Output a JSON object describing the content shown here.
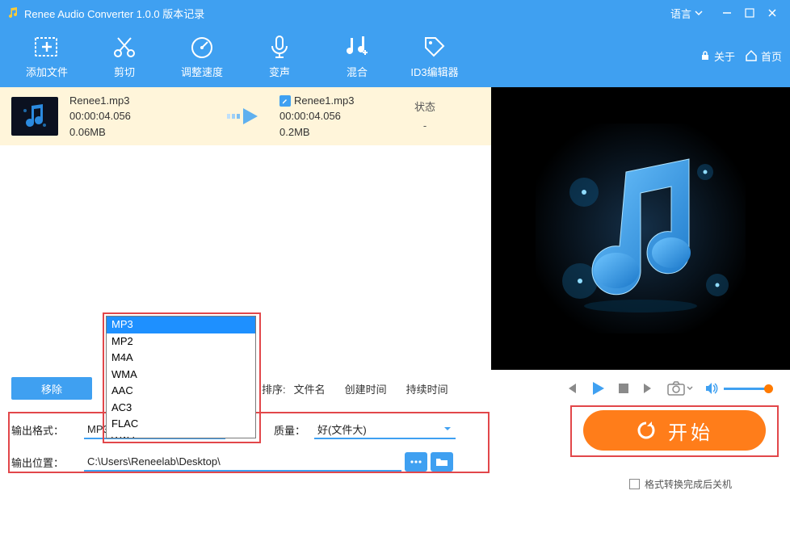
{
  "titlebar": {
    "title": "Renee Audio Converter 1.0.0 版本记录",
    "language": "语言"
  },
  "toolbar": {
    "add": "添加文件",
    "trim": "剪切",
    "speed": "调整速度",
    "voice": "变声",
    "mix": "混合",
    "id3": "ID3编辑器",
    "about": "关于",
    "home": "首页"
  },
  "file": {
    "in_name": "Renee1.mp3",
    "in_dur": "00:00:04.056",
    "in_size": "0.06MB",
    "out_name": "Renee1.mp3",
    "out_dur": "00:00:04.056",
    "out_size": "0.2MB",
    "status_header": "状态",
    "status_value": "-"
  },
  "formats": [
    "MP3",
    "MP2",
    "M4A",
    "WMA",
    "AAC",
    "AC3",
    "FLAC",
    "WAV"
  ],
  "actions": {
    "remove": "移除",
    "sort_label": "排序:",
    "sort_name": "文件名",
    "sort_created": "创建时间",
    "sort_duration": "持续时间"
  },
  "output": {
    "format_label": "输出格式：",
    "format_value": "MP3",
    "quality_label": "质量：",
    "quality_value": "好(文件大)",
    "path_label": "输出位置：",
    "path_value": "C:\\Users\\Reneelab\\Desktop\\"
  },
  "start": {
    "label": "开始"
  },
  "shutdown": {
    "label": "格式转换完成后关机"
  }
}
